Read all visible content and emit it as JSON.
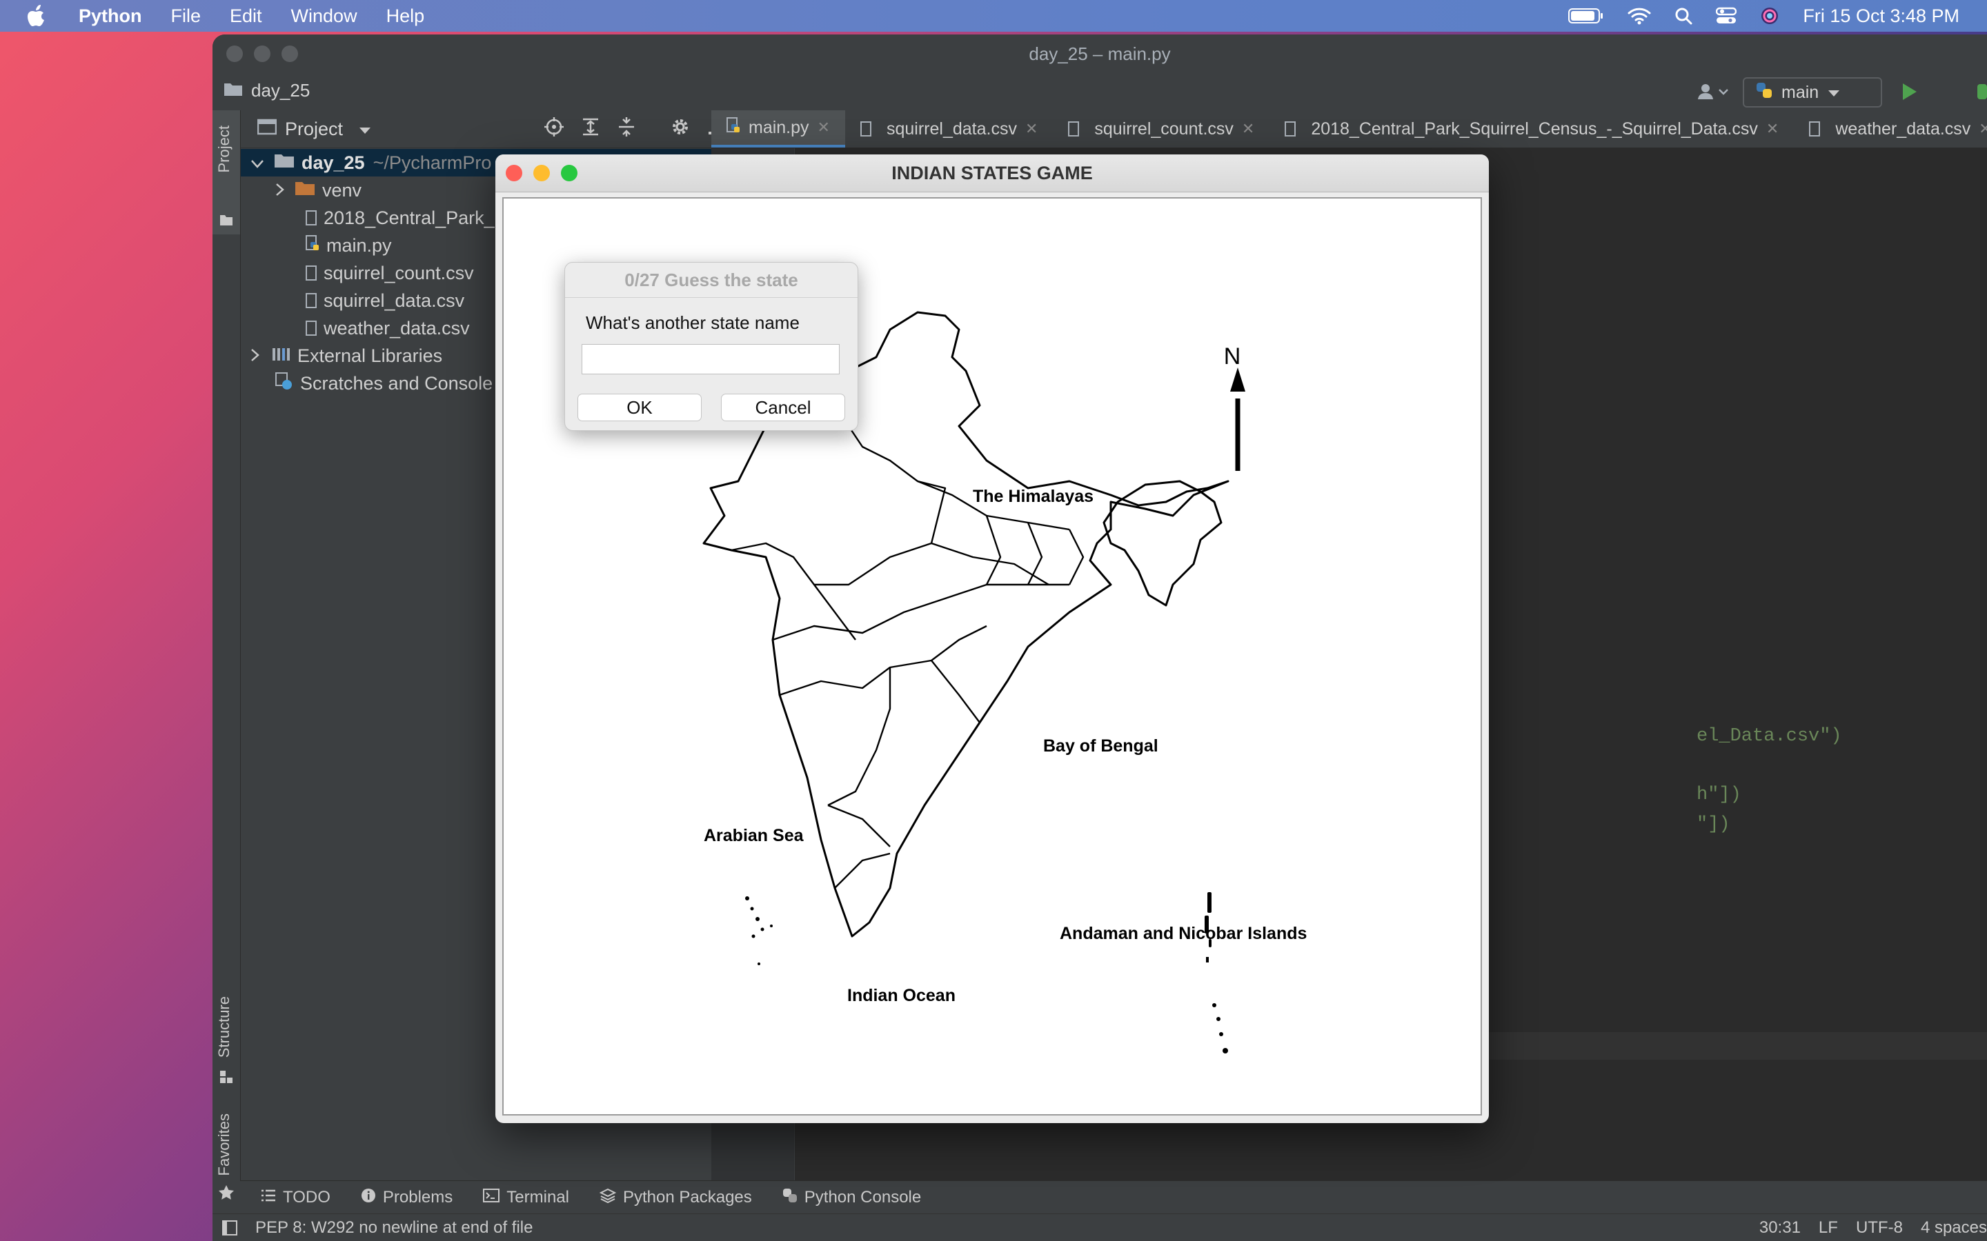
{
  "menubar": {
    "app_name": "Python",
    "menus": [
      "File",
      "Edit",
      "Window",
      "Help"
    ],
    "clock": "Fri 15 Oct  3:48 PM"
  },
  "ide": {
    "window_title": "day_25 – main.py",
    "breadcrumb": "day_25",
    "branch": "main",
    "project_label": "Project",
    "tree": {
      "root_name": "day_25",
      "root_path": "~/PycharmPro",
      "items": [
        "venv",
        "2018_Central_Park_",
        "main.py",
        "squirrel_count.csv",
        "squirrel_data.csv",
        "weather_data.csv"
      ],
      "external": "External Libraries",
      "scratches": "Scratches and Console"
    },
    "tabs": [
      "main.py",
      "squirrel_data.csv",
      "squirrel_count.csv",
      "2018_Central_Park_Squirrel_Census_-_Squirrel_Data.csv",
      "weather_data.csv"
    ],
    "code_fragments": [
      "el_Data.csv\")",
      "h\"])",
      "\"])"
    ],
    "side_tabs": {
      "project": "Project",
      "structure": "Structure",
      "favorites": "Favorites"
    },
    "tool_windows": [
      "TODO",
      "Problems",
      "Terminal",
      "Python Packages",
      "Python Console"
    ],
    "status": {
      "message": "PEP 8: W292 no newline at end of file",
      "position": "30:31",
      "line_sep": "LF",
      "encoding": "UTF-8",
      "indent": "4 spaces"
    }
  },
  "game": {
    "title": "INDIAN STATES GAME",
    "map_labels": {
      "himalayas": "The Himalayas",
      "bay": "Bay of Bengal",
      "arabian": "Arabian Sea",
      "andaman": "Andaman and Nicobar Islands",
      "indian_ocean": "Indian Ocean",
      "north": "N"
    }
  },
  "dialog": {
    "title": "0/27  Guess the state",
    "prompt": "What's another state name",
    "input_value": "",
    "ok": "OK",
    "cancel": "Cancel"
  },
  "colors": {
    "ide_bg": "#2b2b2b",
    "ide_panel": "#3c3f41",
    "selection": "#0d293e",
    "tab_accent": "#4a88c7",
    "close_red": "#fe5f57",
    "min_yellow": "#febc2e",
    "max_green": "#28c840"
  }
}
